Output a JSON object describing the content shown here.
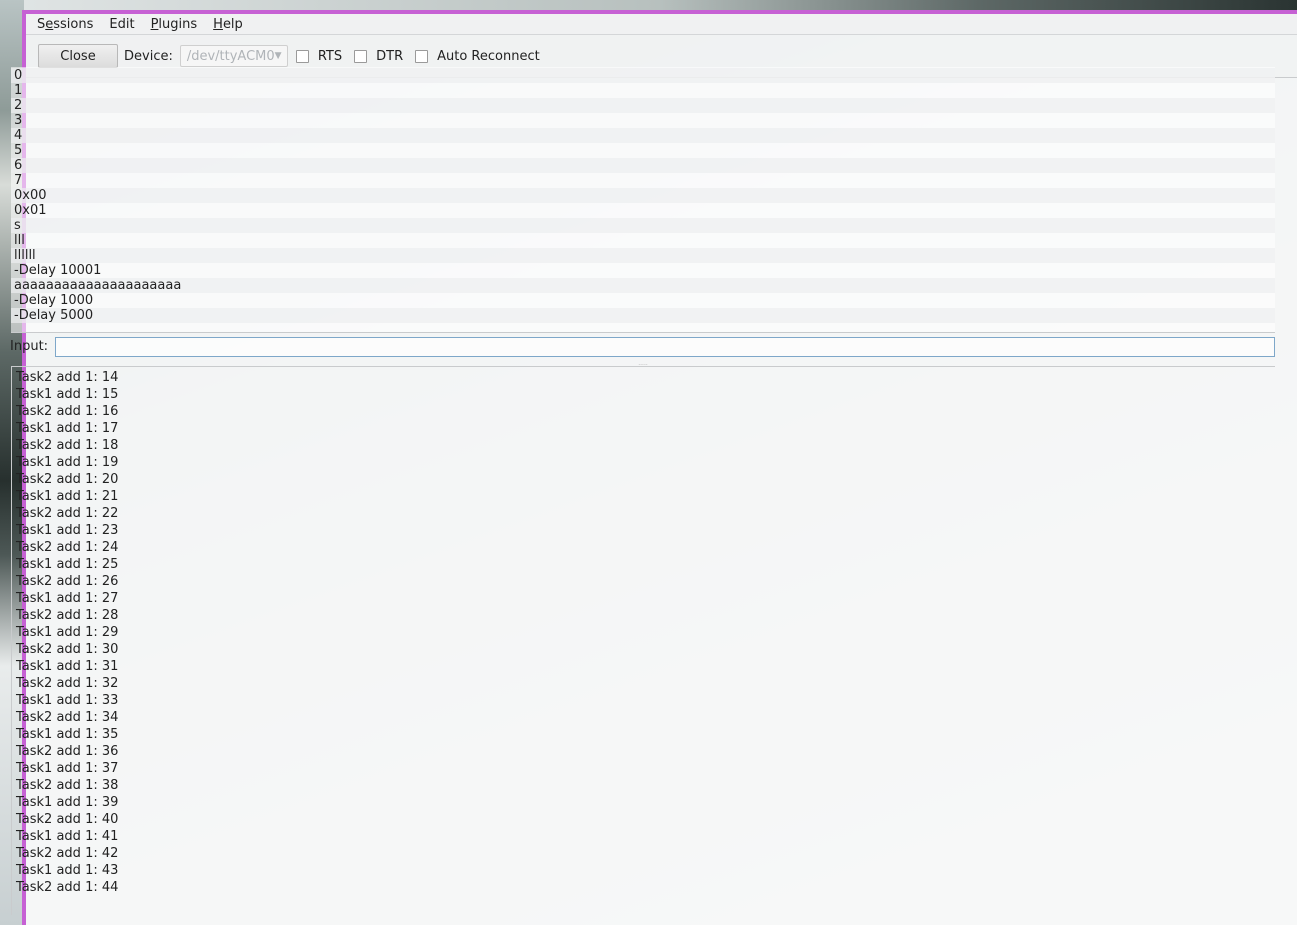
{
  "menubar": {
    "items": [
      {
        "pre": "S",
        "u": "e",
        "post": "ssions"
      },
      {
        "pre": "Edit",
        "u": "",
        "post": ""
      },
      {
        "pre": "",
        "u": "P",
        "post": "lugins"
      },
      {
        "pre": "",
        "u": "H",
        "post": "elp"
      }
    ]
  },
  "toolbar": {
    "close_label": "Close",
    "device_label": "Device:",
    "device_value": "/dev/ttyACM0",
    "rts_label": "RTS",
    "dtr_label": "DTR",
    "auto_reconnect_label": "Auto Reconnect"
  },
  "history": [
    "0",
    "1",
    "2",
    "3",
    "4",
    "5",
    "6",
    "7",
    "0x00",
    "0x01",
    "s",
    "lll",
    "llllll",
    "-Delay 10001",
    "aaaaaaaaaaaaaaaaaaaaa",
    "-Delay 1000",
    "-Delay 5000"
  ],
  "input": {
    "label": "Input:",
    "value": ""
  },
  "splitter": ".....",
  "output": [
    "Task2 add 1: 14",
    "Task1 add 1: 15",
    "Task2 add 1: 16",
    "Task1 add 1: 17",
    "Task2 add 1: 18",
    "Task1 add 1: 19",
    "Task2 add 1: 20",
    "Task1 add 1: 21",
    "Task2 add 1: 22",
    "Task1 add 1: 23",
    "Task2 add 1: 24",
    "Task1 add 1: 25",
    "Task2 add 1: 26",
    "Task1 add 1: 27",
    "Task2 add 1: 28",
    "Task1 add 1: 29",
    "Task2 add 1: 30",
    "Task1 add 1: 31",
    "Task2 add 1: 32",
    "Task1 add 1: 33",
    "Task2 add 1: 34",
    "Task1 add 1: 35",
    "Task2 add 1: 36",
    "Task1 add 1: 37",
    "Task2 add 1: 38",
    "Task1 add 1: 39",
    "Task2 add 1: 40",
    "Task1 add 1: 41",
    "Task2 add 1: 42",
    "Task1 add 1: 43",
    "Task2 add 1: 44"
  ],
  "colors": {
    "window_border": "#c661d4",
    "input_border": "#7ea7c9"
  }
}
